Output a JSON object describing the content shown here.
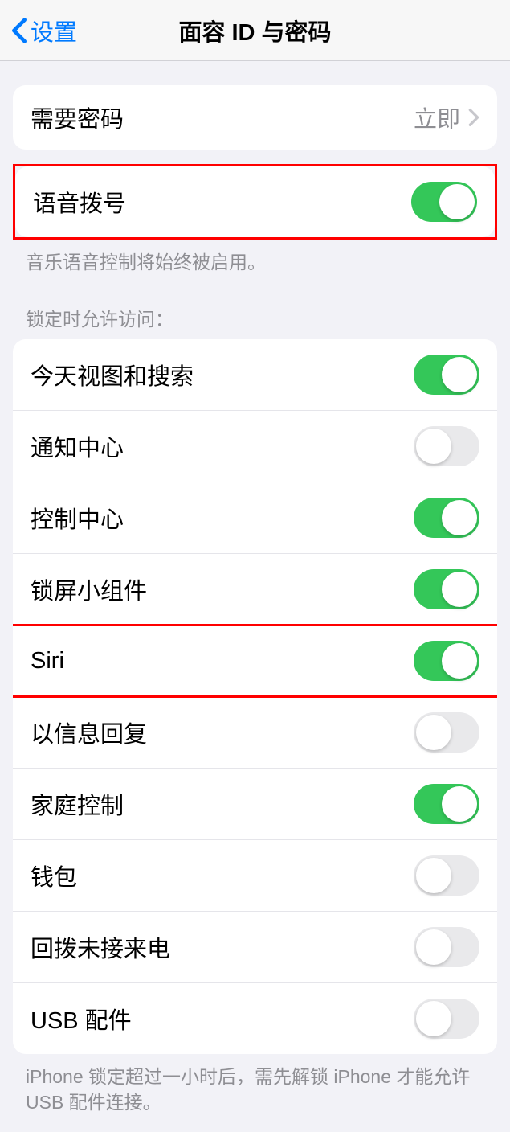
{
  "nav": {
    "back_label": "设置",
    "title": "面容 ID 与密码"
  },
  "require_passcode": {
    "label": "需要密码",
    "value": "立即"
  },
  "voice_dial": {
    "label": "语音拨号",
    "on": true,
    "footer": "音乐语音控制将始终被启用。"
  },
  "locked_header": "锁定时允许访问：",
  "locked_access": [
    {
      "label": "今天视图和搜索",
      "on": true
    },
    {
      "label": "通知中心",
      "on": false
    },
    {
      "label": "控制中心",
      "on": true
    },
    {
      "label": "锁屏小组件",
      "on": true
    },
    {
      "label": "Siri",
      "on": true
    },
    {
      "label": "以信息回复",
      "on": false
    },
    {
      "label": "家庭控制",
      "on": true
    },
    {
      "label": "钱包",
      "on": false
    },
    {
      "label": "回拨未接来电",
      "on": false
    },
    {
      "label": "USB 配件",
      "on": false
    }
  ],
  "usb_footer": "iPhone 锁定超过一小时后，需先解锁 iPhone 才能允许USB 配件连接。"
}
